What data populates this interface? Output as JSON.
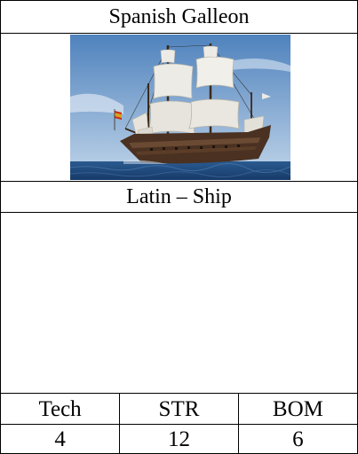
{
  "card": {
    "title": "Spanish Galleon",
    "subtitle": "Latin – Ship",
    "image": {
      "icon": "galleon-ship-image",
      "colors": {
        "sky_top": "#4f82bd",
        "sky_bottom": "#b3cbe4",
        "sea": "#1d4579",
        "hull": "#4a3121",
        "sail": "#ecebe5"
      }
    },
    "stats": {
      "headers": [
        "Tech",
        "STR",
        "BOM"
      ],
      "values": [
        "4",
        "12",
        "6"
      ]
    }
  }
}
